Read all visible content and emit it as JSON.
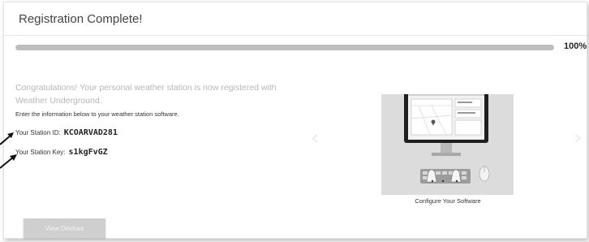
{
  "header": {
    "title": "Registration Complete!"
  },
  "progress": {
    "percent": 100,
    "label": "100%"
  },
  "message": {
    "congrats": "Congratulations! Your personal weather station is now registered with Weather Underground.",
    "instruction": "Enter the information below to your weather station software."
  },
  "station": {
    "id_label": "Your Station ID:",
    "id_value": "KCOARVAD281",
    "key_label": "Your Station Key:",
    "key_value": "s1kgFvGZ"
  },
  "carousel": {
    "caption": "Configure Your Software",
    "prev_icon": "chevron-left",
    "next_icon": "chevron-right"
  },
  "actions": {
    "view_devices_label": "View Devices"
  },
  "colors": {
    "progress_fill": "#bdbdbd",
    "progress_track": "#e3e3e3",
    "button_bg": "#cfcfcf",
    "muted_text": "#b7b7b7"
  }
}
